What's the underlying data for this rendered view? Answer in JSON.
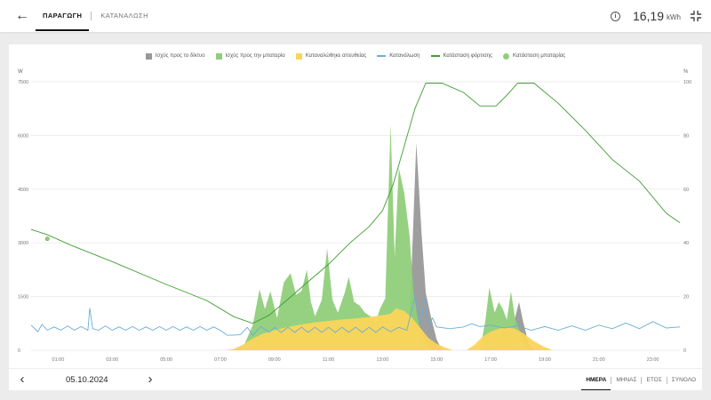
{
  "header": {
    "tabs": [
      {
        "label": "ΠΑΡΑΓΩΓΗ",
        "active": true
      },
      {
        "label": "ΚΑΤΑΝΑΛΩΣΗ",
        "active": false
      }
    ],
    "energy_value": "16,19",
    "energy_unit": "kWh",
    "icons": {
      "back": "arrow-left-icon",
      "info": "info-icon",
      "collapse": "collapse-icon"
    }
  },
  "footer": {
    "date": "05.10.2024",
    "periods": [
      {
        "label": "ΗΜΕΡΑ",
        "active": true
      },
      {
        "label": "ΜΗΝΑΣ",
        "active": false
      },
      {
        "label": "ΕΤΟΣ",
        "active": false
      },
      {
        "label": "ΣΥΝΟΛΟ",
        "active": false
      }
    ]
  },
  "colors": {
    "grid_export": "#999999",
    "battery_charge": "#8fcf7a",
    "direct_consumption": "#fbd55a",
    "consumption_line": "#6aaed6",
    "soc_line": "#3f9e31"
  },
  "chart_data": {
    "type": "area",
    "legend": [
      {
        "name": "Ισχύς προς το δίκτυο",
        "kind": "box",
        "color": "#999999"
      },
      {
        "name": "Ισχύς προς την μπαταρία",
        "kind": "box",
        "color": "#8fcf7a"
      },
      {
        "name": "Καταναλώθηκε απευθείας",
        "kind": "box",
        "color": "#fbd55a"
      },
      {
        "name": "Κατανάλωση",
        "kind": "line",
        "color": "#6aaed6"
      },
      {
        "name": "Κατάσταση φόρτισης",
        "kind": "line",
        "color": "#3f9e31"
      },
      {
        "name": "Κατάσταση μπαταρίας",
        "kind": "dot",
        "color": "#8fcf7a"
      }
    ],
    "ylabel_left": "W",
    "ylabel_right": "%",
    "ylim_left": [
      0,
      7500
    ],
    "ylim_right": [
      0,
      100
    ],
    "yticks_left": [
      "0",
      "1500",
      "3000",
      "4500",
      "6000",
      "7500"
    ],
    "yticks_right": [
      "0",
      "20",
      "40",
      "60",
      "80",
      "100"
    ],
    "xlim_hours": [
      0,
      24
    ],
    "xticks": [
      "01:00",
      "03:00",
      "05:00",
      "07:00",
      "09:00",
      "11:00",
      "13:00",
      "15:00",
      "17:00",
      "19:00",
      "21:00",
      "23:00"
    ],
    "grid": true,
    "series": [
      {
        "name": "Κατάσταση φόρτισης",
        "unit": "%",
        "points": [
          [
            0,
            45
          ],
          [
            0.6,
            43
          ],
          [
            1.5,
            39
          ],
          [
            3,
            33
          ],
          [
            5,
            24.5
          ],
          [
            6.5,
            18.5
          ],
          [
            7.5,
            12.5
          ],
          [
            8.2,
            10
          ],
          [
            8.8,
            13
          ],
          [
            9.5,
            19
          ],
          [
            10.3,
            26
          ],
          [
            11,
            32
          ],
          [
            11.8,
            40
          ],
          [
            12.5,
            46
          ],
          [
            13,
            52
          ],
          [
            13.4,
            62
          ],
          [
            13.8,
            76
          ],
          [
            14.2,
            90
          ],
          [
            14.6,
            99.5
          ],
          [
            15.2,
            99.5
          ],
          [
            16,
            96
          ],
          [
            16.6,
            91
          ],
          [
            17.2,
            91
          ],
          [
            17.6,
            95
          ],
          [
            18,
            99.5
          ],
          [
            18.6,
            99.5
          ],
          [
            19.5,
            92
          ],
          [
            20.5,
            82
          ],
          [
            21.5,
            71
          ],
          [
            22.5,
            63
          ],
          [
            23.5,
            51
          ],
          [
            24,
            47.5
          ]
        ]
      },
      {
        "name": "Κατάσταση μπαταρίας",
        "unit": "%",
        "points": [
          [
            0.6,
            41.5
          ]
        ]
      },
      {
        "name": "Ισχύς προς την μπαταρία",
        "unit": "W",
        "points": [
          [
            7.5,
            0
          ],
          [
            7.9,
            180
          ],
          [
            8.2,
            700
          ],
          [
            8.45,
            1700
          ],
          [
            8.65,
            1150
          ],
          [
            8.85,
            1650
          ],
          [
            9.1,
            900
          ],
          [
            9.35,
            1900
          ],
          [
            9.6,
            2150
          ],
          [
            9.8,
            1550
          ],
          [
            10,
            1650
          ],
          [
            10.2,
            2250
          ],
          [
            10.35,
            1350
          ],
          [
            10.5,
            950
          ],
          [
            10.75,
            1400
          ],
          [
            10.95,
            2850
          ],
          [
            11.15,
            1400
          ],
          [
            11.35,
            1050
          ],
          [
            11.6,
            1600
          ],
          [
            11.75,
            2050
          ],
          [
            11.95,
            1350
          ],
          [
            12.15,
            1250
          ],
          [
            12.35,
            1050
          ],
          [
            12.55,
            950
          ],
          [
            12.75,
            780
          ],
          [
            12.9,
            1150
          ],
          [
            13.1,
            1450
          ],
          [
            13.3,
            6300
          ],
          [
            13.45,
            2600
          ],
          [
            13.6,
            5100
          ],
          [
            13.8,
            4400
          ],
          [
            14,
            3200
          ],
          [
            14.15,
            1600
          ],
          [
            14.3,
            900
          ],
          [
            14.45,
            380
          ],
          [
            14.6,
            150
          ],
          [
            14.9,
            0
          ],
          [
            16.6,
            0
          ],
          [
            16.8,
            800
          ],
          [
            16.95,
            1750
          ],
          [
            17.15,
            1050
          ],
          [
            17.3,
            1350
          ],
          [
            17.45,
            1150
          ],
          [
            17.6,
            850
          ],
          [
            17.75,
            1650
          ],
          [
            17.9,
            900
          ],
          [
            18.1,
            500
          ],
          [
            18.3,
            120
          ],
          [
            18.5,
            0
          ]
        ]
      },
      {
        "name": "Ισχύς προς το δίκτυο",
        "unit": "W",
        "points": [
          [
            13.9,
            0
          ],
          [
            14.05,
            1800
          ],
          [
            14.25,
            5800
          ],
          [
            14.45,
            3200
          ],
          [
            14.6,
            1600
          ],
          [
            14.8,
            900
          ],
          [
            15,
            300
          ],
          [
            15.2,
            0
          ],
          [
            17.7,
            0
          ],
          [
            17.9,
            900
          ],
          [
            18.05,
            1350
          ],
          [
            18.2,
            800
          ],
          [
            18.4,
            200
          ],
          [
            18.6,
            0
          ]
        ]
      },
      {
        "name": "Καταναλώθηκε απευθείας",
        "unit": "W",
        "points": [
          [
            7.2,
            0
          ],
          [
            7.5,
            40
          ],
          [
            7.8,
            140
          ],
          [
            8.2,
            330
          ],
          [
            8.6,
            470
          ],
          [
            9,
            560
          ],
          [
            9.5,
            650
          ],
          [
            10,
            720
          ],
          [
            10.5,
            780
          ],
          [
            11,
            820
          ],
          [
            11.5,
            860
          ],
          [
            12,
            890
          ],
          [
            12.5,
            930
          ],
          [
            13,
            980
          ],
          [
            13.3,
            1020
          ],
          [
            13.5,
            1170
          ],
          [
            13.8,
            1100
          ],
          [
            14.1,
            900
          ],
          [
            14.4,
            620
          ],
          [
            14.7,
            340
          ],
          [
            15,
            180
          ],
          [
            15.3,
            80
          ],
          [
            15.6,
            0
          ],
          [
            16.1,
            0
          ],
          [
            16.4,
            150
          ],
          [
            16.7,
            380
          ],
          [
            17,
            520
          ],
          [
            17.3,
            600
          ],
          [
            17.6,
            640
          ],
          [
            17.9,
            600
          ],
          [
            18.2,
            480
          ],
          [
            18.6,
            250
          ],
          [
            19,
            90
          ],
          [
            19.3,
            0
          ]
        ]
      },
      {
        "name": "Κατανάλωση",
        "unit": "W",
        "points": [
          [
            0,
            700
          ],
          [
            0.25,
            520
          ],
          [
            0.4,
            720
          ],
          [
            0.6,
            560
          ],
          [
            0.85,
            650
          ],
          [
            1.1,
            560
          ],
          [
            1.35,
            680
          ],
          [
            1.6,
            560
          ],
          [
            1.85,
            660
          ],
          [
            2.1,
            560
          ],
          [
            2.17,
            1180
          ],
          [
            2.28,
            600
          ],
          [
            2.5,
            560
          ],
          [
            2.75,
            680
          ],
          [
            3,
            560
          ],
          [
            3.25,
            650
          ],
          [
            3.5,
            560
          ],
          [
            3.75,
            660
          ],
          [
            4,
            560
          ],
          [
            4.25,
            650
          ],
          [
            4.5,
            560
          ],
          [
            4.75,
            660
          ],
          [
            5,
            560
          ],
          [
            5.25,
            660
          ],
          [
            5.5,
            560
          ],
          [
            5.75,
            650
          ],
          [
            6,
            560
          ],
          [
            6.25,
            660
          ],
          [
            6.5,
            560
          ],
          [
            6.75,
            650
          ],
          [
            7,
            560
          ],
          [
            7.25,
            420
          ],
          [
            7.5,
            420
          ],
          [
            7.75,
            440
          ],
          [
            8,
            640
          ],
          [
            8.2,
            420
          ],
          [
            8.5,
            660
          ],
          [
            8.8,
            500
          ],
          [
            9,
            640
          ],
          [
            9.25,
            500
          ],
          [
            9.5,
            640
          ],
          [
            9.75,
            500
          ],
          [
            10,
            640
          ],
          [
            10.25,
            500
          ],
          [
            10.5,
            640
          ],
          [
            10.75,
            500
          ],
          [
            11,
            640
          ],
          [
            11.25,
            500
          ],
          [
            11.5,
            640
          ],
          [
            11.75,
            500
          ],
          [
            12,
            640
          ],
          [
            12.25,
            500
          ],
          [
            12.5,
            640
          ],
          [
            12.75,
            500
          ],
          [
            13,
            650
          ],
          [
            13.3,
            520
          ],
          [
            13.6,
            640
          ],
          [
            13.9,
            560
          ],
          [
            14.2,
            1500
          ],
          [
            14.4,
            760
          ],
          [
            14.55,
            1420
          ],
          [
            14.7,
            700
          ],
          [
            14.85,
            900
          ],
          [
            15,
            650
          ],
          [
            15.5,
            600
          ],
          [
            16,
            650
          ],
          [
            16.3,
            740
          ],
          [
            16.6,
            660
          ],
          [
            17,
            700
          ],
          [
            17.5,
            620
          ],
          [
            18,
            680
          ],
          [
            18.5,
            560
          ],
          [
            19,
            660
          ],
          [
            19.5,
            560
          ],
          [
            20,
            680
          ],
          [
            20.5,
            560
          ],
          [
            21,
            700
          ],
          [
            21.5,
            600
          ],
          [
            22,
            760
          ],
          [
            22.5,
            600
          ],
          [
            23,
            800
          ],
          [
            23.5,
            620
          ],
          [
            24,
            650
          ]
        ]
      }
    ]
  }
}
